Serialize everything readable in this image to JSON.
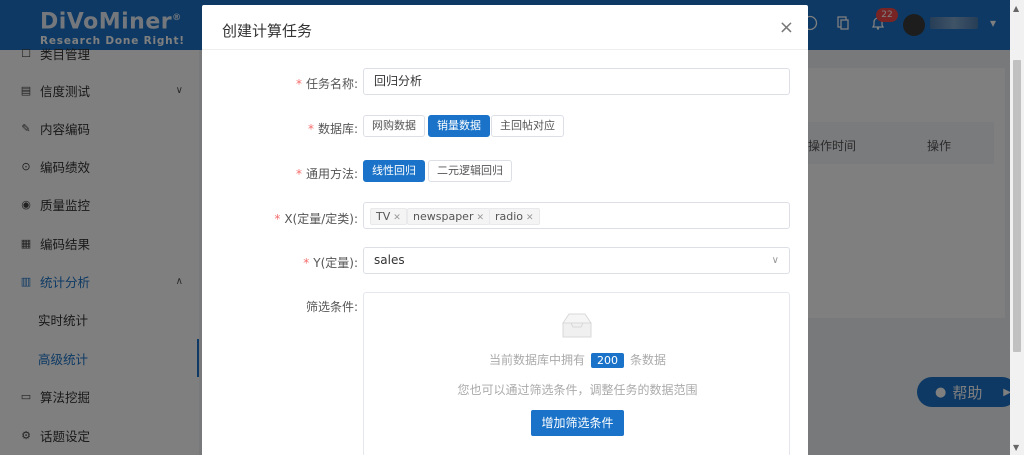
{
  "app": {
    "logo_text": "DiVoMiner",
    "logo_reg": "®",
    "tagline": "Research Done Right!",
    "notif_count": "22",
    "brand_color": "#1a73c8"
  },
  "sidebar": {
    "items": [
      {
        "label": "类目管理",
        "icon": "list-icon"
      },
      {
        "label": "信度测试",
        "icon": "document-check-icon"
      },
      {
        "label": "内容编码",
        "icon": "pencil-icon"
      },
      {
        "label": "编码绩效",
        "icon": "coin-icon"
      },
      {
        "label": "质量监控",
        "icon": "eye-icon"
      },
      {
        "label": "编码结果",
        "icon": "document-icon"
      },
      {
        "label": "统计分析",
        "icon": "bar-chart-icon"
      },
      {
        "label": "算法挖掘",
        "icon": "monitor-icon"
      },
      {
        "label": "话题设定",
        "icon": "gear-icon"
      }
    ],
    "sub_items": [
      {
        "label": "实时统计"
      },
      {
        "label": "高级统计"
      }
    ]
  },
  "background_table": {
    "headers": [
      "操作时间",
      "操作"
    ]
  },
  "help": {
    "label": "帮助"
  },
  "dialog": {
    "title": "创建计算任务",
    "close_symbol": "×",
    "fields": {
      "task_name": {
        "label": "任务名称:",
        "value": "回归分析"
      },
      "database": {
        "label": "数据库:",
        "options": [
          "网购数据",
          "销量数据",
          "主回帖对应"
        ],
        "selected": "销量数据"
      },
      "method": {
        "label": "通用方法:",
        "options": [
          "线性回归",
          "二元逻辑回归"
        ],
        "selected": "线性回归"
      },
      "x_vars": {
        "label": "X(定量/定类):",
        "tags": [
          "TV",
          "newspaper",
          "radio"
        ]
      },
      "y_var": {
        "label": "Y(定量):",
        "value": "sales"
      },
      "filter": {
        "label": "筛选条件:",
        "count_prefix": "当前数据库中拥有",
        "count": "200",
        "count_suffix": "条数据",
        "hint": "您也可以通过筛选条件，调整任务的数据范围",
        "add_button": "增加筛选条件"
      }
    }
  }
}
